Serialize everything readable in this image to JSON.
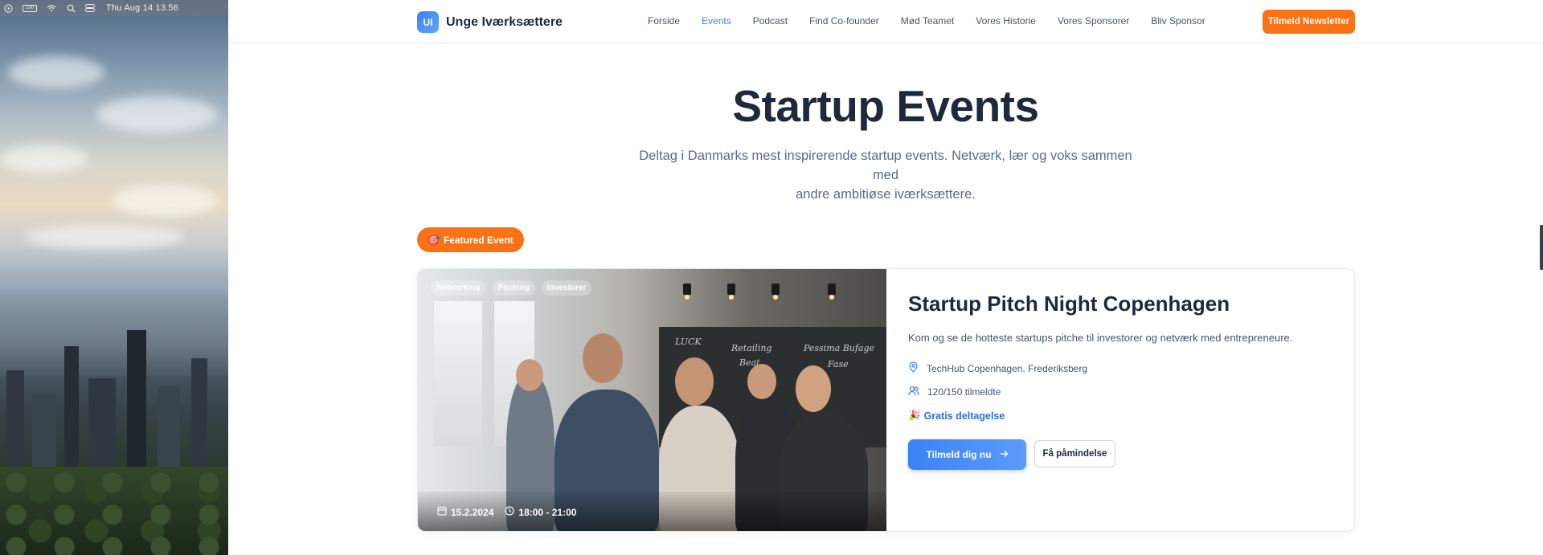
{
  "menubar": {
    "battery_label": "100",
    "clock": "Thu Aug 14  13.56"
  },
  "brand": {
    "badge": "UI",
    "name": "Unge Iværksættere"
  },
  "nav": {
    "items": [
      {
        "label": "Forside",
        "active": false
      },
      {
        "label": "Events",
        "active": true
      },
      {
        "label": "Podcast",
        "active": false
      },
      {
        "label": "Find Co-founder",
        "active": false
      },
      {
        "label": "Mød Teamet",
        "active": false
      },
      {
        "label": "Vores Historie",
        "active": false
      },
      {
        "label": "Vores Sponsorer",
        "active": false
      },
      {
        "label": "Bliv Sponsor",
        "active": false
      }
    ],
    "cta": "Tilmeld Newsletter"
  },
  "hero": {
    "title": "Startup Events",
    "subtitle_line1": "Deltag i Danmarks mest inspirerende startup events. Netværk, lær og voks sammen med",
    "subtitle_line2": "andre ambitiøse iværksættere."
  },
  "featured": {
    "pill_icon": "🎯",
    "pill_label": "Featured Event"
  },
  "event": {
    "tags": [
      "Networking",
      "Pitching",
      "Investorer"
    ],
    "date": "15.2.2024",
    "time": "18:00 - 21:00",
    "title": "Startup Pitch Night Copenhagen",
    "description": "Kom og se de hotteste startups pitche til investorer og netværk med entrepreneure.",
    "location": "TechHub Copenhagen, Frederiksberg",
    "attendees": "120/150 tilmeldte",
    "price_icon": "🎉",
    "price": "Gratis deltagelse",
    "signup_label": "Tilmeld dig nu",
    "remind_label": "Få påmindelse",
    "image_board_text": [
      "LUCK",
      "Retailing",
      "Beat",
      "Pessima Bufage",
      "Fase"
    ]
  },
  "colors": {
    "accent_blue": "#3b82f6",
    "accent_orange": "#f97316",
    "heading": "#1e293b",
    "muted": "#475569"
  }
}
